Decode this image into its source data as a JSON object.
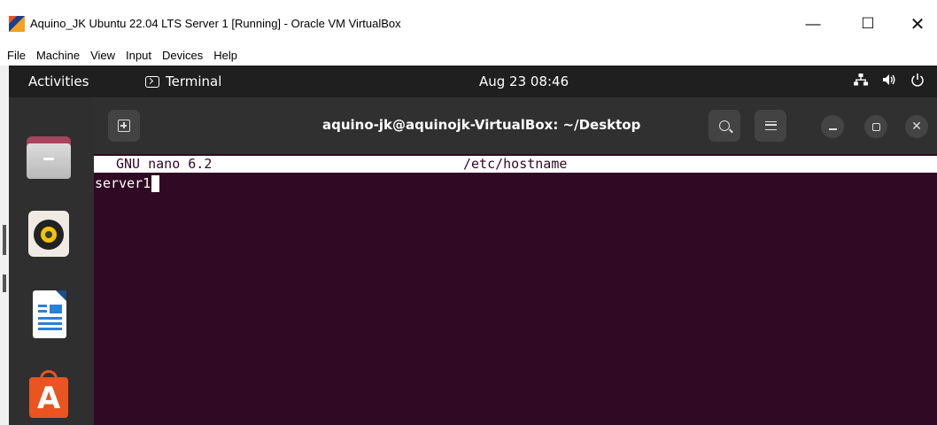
{
  "vbox": {
    "title": "Aquino_JK Ubuntu 22.04 LTS Server 1 [Running] - Oracle VM VirtualBox",
    "controls": {
      "minimize": "—",
      "maximize": "☐",
      "close": "✕"
    },
    "menu": [
      "File",
      "Machine",
      "View",
      "Input",
      "Devices",
      "Help"
    ]
  },
  "gnome": {
    "activities": "Activities",
    "app_name": "Terminal",
    "clock": "Aug 23  08:46",
    "icons": {
      "network": "network-icon",
      "volume": "volume-icon",
      "power": "power-icon"
    }
  },
  "dock": {
    "items": [
      "files-icon",
      "rhythmbox-icon",
      "libreoffice-writer-icon",
      "ubuntu-software-icon"
    ],
    "software_letter": "A"
  },
  "terminal": {
    "title": "aquino-jk@aquinojk-VirtualBox: ~/Desktop",
    "close_glyph": "✕"
  },
  "nano": {
    "version": "GNU nano 6.2",
    "filename": "/etc/hostname",
    "content": "server1"
  },
  "colors": {
    "terminal_bg": "#300a24",
    "ubuntu_orange": "#e95420",
    "topbar_bg": "#1f1f1f",
    "headerbar_bg": "#303030"
  }
}
